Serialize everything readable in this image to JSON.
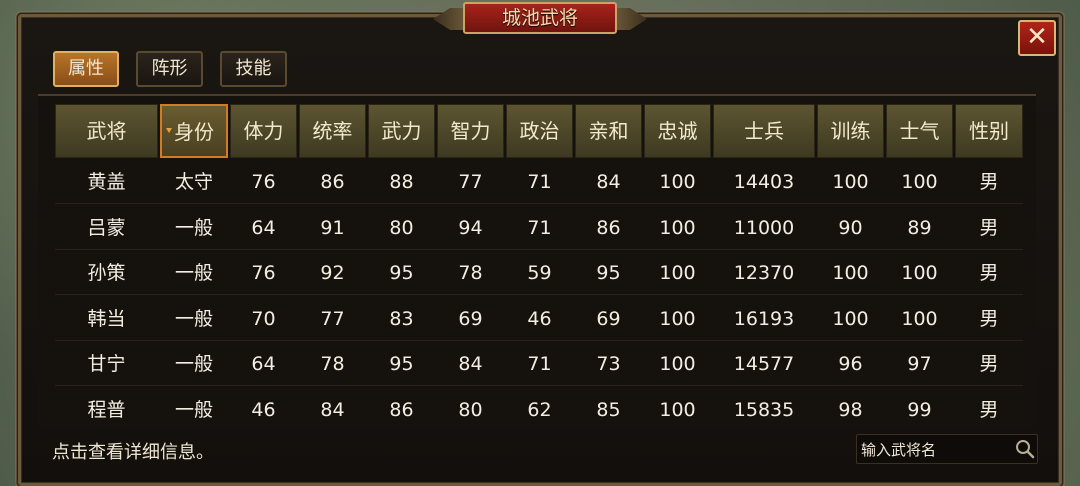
{
  "window": {
    "title": "城池武将",
    "close_label": "✕"
  },
  "tabs": [
    {
      "label": "属性",
      "active": true
    },
    {
      "label": "阵形",
      "active": false
    },
    {
      "label": "技能",
      "active": false
    }
  ],
  "table": {
    "headers": [
      "武将",
      "身份",
      "体力",
      "统率",
      "武力",
      "智力",
      "政治",
      "亲和",
      "忠诚",
      "士兵",
      "训练",
      "士气",
      "性别"
    ],
    "sorted_column": "身份",
    "rows": [
      [
        "黄盖",
        "太守",
        "76",
        "86",
        "88",
        "77",
        "71",
        "84",
        "100",
        "14403",
        "100",
        "100",
        "男"
      ],
      [
        "吕蒙",
        "一般",
        "64",
        "91",
        "80",
        "94",
        "71",
        "86",
        "100",
        "11000",
        "90",
        "89",
        "男"
      ],
      [
        "孙策",
        "一般",
        "76",
        "92",
        "95",
        "78",
        "59",
        "95",
        "100",
        "12370",
        "100",
        "100",
        "男"
      ],
      [
        "韩当",
        "一般",
        "70",
        "77",
        "83",
        "69",
        "46",
        "69",
        "100",
        "16193",
        "100",
        "100",
        "男"
      ],
      [
        "甘宁",
        "一般",
        "64",
        "78",
        "95",
        "84",
        "71",
        "73",
        "100",
        "14577",
        "96",
        "97",
        "男"
      ],
      [
        "程普",
        "一般",
        "46",
        "84",
        "86",
        "80",
        "62",
        "85",
        "100",
        "15835",
        "98",
        "99",
        "男"
      ]
    ]
  },
  "footer": {
    "hint": "点击查看详细信息。",
    "search_placeholder": "输入武将名"
  },
  "colors": {
    "accent_orange": "#d47a22",
    "title_red": "#a8231b",
    "header_olive": "#5d5531",
    "text_cream": "#f4eee2"
  },
  "icons": {
    "close": "close-icon",
    "search": "search-icon",
    "sort": "sort-arrow-icon"
  }
}
